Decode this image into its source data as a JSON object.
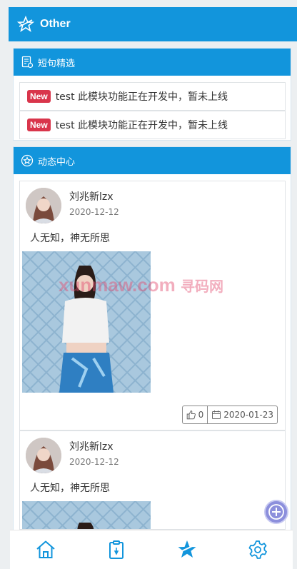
{
  "header": {
    "title": "Other"
  },
  "sections": {
    "short_sentences": {
      "title": "短句精选"
    },
    "feed": {
      "title": "动态中心"
    }
  },
  "news": [
    {
      "badge": "New",
      "text": "test 此模块功能正在开发中，暂未上线"
    },
    {
      "badge": "New",
      "text": "test 此模块功能正在开发中，暂未上线"
    }
  ],
  "posts": [
    {
      "author": "刘兆新lzx",
      "date": "2020-12-12",
      "content": "人无知，神无所思",
      "likes": "0",
      "post_date": "2020-01-23"
    },
    {
      "author": "刘兆新lzx",
      "date": "2020-12-12",
      "content": "人无知，神无所思"
    }
  ],
  "watermark": {
    "latin": "xunmaw.com",
    "cn": "寻码网"
  },
  "icons": {
    "header": "star-logo-icon",
    "short_sentences": "document-list-icon",
    "feed": "star-circle-icon",
    "like": "thumbs-up-icon",
    "calendar": "calendar-icon",
    "fab": "plus-circle-icon",
    "tab_home": "home-icon",
    "tab_clipboard": "clipboard-icon",
    "tab_star": "star-logo-icon",
    "tab_settings": "gear-icon"
  },
  "colors": {
    "primary": "#1295dc",
    "badge": "#d9354b",
    "fab": "#8c8fdc"
  }
}
